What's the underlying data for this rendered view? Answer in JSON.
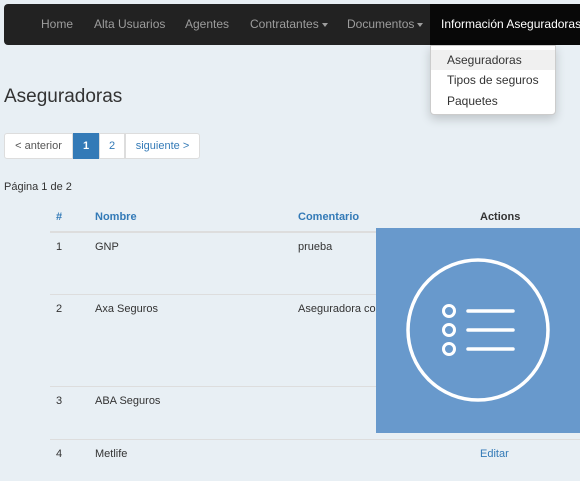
{
  "navbar": {
    "items": [
      {
        "label": "Home"
      },
      {
        "label": "Alta Usuarios"
      },
      {
        "label": "Agentes"
      },
      {
        "label": "Contratantes"
      },
      {
        "label": "Documentos"
      },
      {
        "label": "Información Aseguradoras"
      }
    ]
  },
  "dropdown": {
    "items": [
      {
        "label": "Aseguradoras"
      },
      {
        "label": "Tipos de seguros"
      },
      {
        "label": "Paquetes"
      }
    ]
  },
  "page": {
    "title": "Aseguradoras"
  },
  "pagination": {
    "prev": "< anterior",
    "pages": [
      "1",
      "2"
    ],
    "next": "siguiente >",
    "info": "Página 1 de 2"
  },
  "table": {
    "headers": {
      "num": "#",
      "name": "Nombre",
      "comment": "Comentario",
      "actions": "Actions"
    },
    "rows": [
      {
        "num": "1",
        "name": "GNP",
        "comment": "prueba"
      },
      {
        "num": "2",
        "name": "Axa Seguros",
        "comment": "Aseguradora co"
      },
      {
        "num": "3",
        "name": "ABA Seguros",
        "comment": ""
      },
      {
        "num": "4",
        "name": "Metlife",
        "comment": "",
        "action": "Editar"
      }
    ]
  },
  "overlay": {
    "icon": "list-icon",
    "color": "#6899cc"
  },
  "colors": {
    "navbar": "#222222",
    "link": "#337ab7",
    "background": "#e8eff4"
  }
}
